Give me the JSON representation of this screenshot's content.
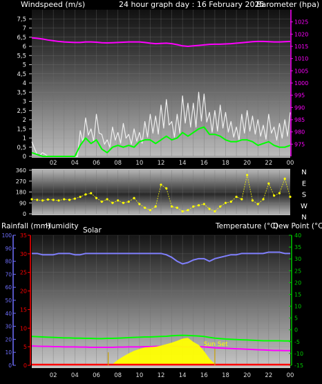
{
  "header": {
    "left": "Windspeed (m/s)",
    "center": "24 hour graph day : 16 February 2025",
    "right": "Barometer (hpa)"
  },
  "mid_header": {
    "rain": "Rainfall (mm)",
    "humidity": "Humidity",
    "solar": "Solar",
    "temperature": "Temperature (°C)",
    "dewpoint": "Dew Point (°C)"
  },
  "colors": {
    "wind_gust": "#f0f0f0",
    "wind_avg": "#00ff00",
    "barometer": "#ff00ff",
    "wind_dir": "#ffff00",
    "temperature": "#00ff00",
    "dewpoint": "#ff00ff",
    "humidity": "#8080ff",
    "solar": "#ffff00",
    "rain": "#ff0000",
    "rain_axis": "#ff0000",
    "humidity_axis": "#7070ff",
    "temp_axis": "#00cc00"
  },
  "x_ticks": [
    "02",
    "04",
    "06",
    "08",
    "10",
    "12",
    "14",
    "16",
    "18",
    "20",
    "22",
    "00"
  ],
  "chart_data": [
    {
      "type": "line",
      "id": "wind-baro",
      "title": "24 hour graph day : 16 February 2025",
      "ylabel": "Windspeed (m/s)",
      "y2label": "Barometer (hpa)",
      "ylim": [
        0,
        8
      ],
      "y2lim": [
        970,
        1030
      ],
      "y_ticks": [
        "0",
        "0,5",
        "1",
        "1,5",
        "2",
        "2,5",
        "3",
        "3,5",
        "4",
        "4,5",
        "5",
        "5,5",
        "6",
        "6,5",
        "7",
        "7,5"
      ],
      "y2_ticks": [
        "975",
        "980",
        "985",
        "990",
        "995",
        "1000",
        "1005",
        "1010",
        "1015",
        "1020",
        "1025"
      ],
      "x_hours": [
        0,
        0.5,
        1,
        1.5,
        2,
        2.5,
        3,
        3.5,
        4,
        4.5,
        5,
        5.5,
        6,
        6.5,
        7,
        7.5,
        8,
        8.5,
        9,
        9.5,
        10,
        10.5,
        11,
        11.5,
        12,
        12.5,
        13,
        13.5,
        14,
        14.5,
        15,
        15.5,
        16,
        16.5,
        17,
        17.5,
        18,
        18.5,
        19,
        19.5,
        20,
        20.5,
        21,
        21.5,
        22,
        22.5,
        23,
        23.5,
        24
      ],
      "series": [
        {
          "key": "barometer",
          "axis": "y2",
          "values": [
            1018.5,
            1018.3,
            1018,
            1017.6,
            1017.3,
            1017,
            1016.8,
            1016.7,
            1016.6,
            1016.6,
            1016.8,
            1016.8,
            1016.7,
            1016.5,
            1016.4,
            1016.5,
            1016.6,
            1016.7,
            1016.8,
            1016.8,
            1016.8,
            1016.6,
            1016.3,
            1016.1,
            1016.2,
            1016.3,
            1016.1,
            1015.7,
            1015.2,
            1015,
            1015.2,
            1015.4,
            1015.6,
            1015.8,
            1015.9,
            1015.9,
            1016,
            1016.1,
            1016.3,
            1016.5,
            1016.7,
            1016.9,
            1017,
            1017,
            1016.9,
            1016.8,
            1016.8,
            1016.9,
            1017
          ]
        },
        {
          "key": "wind_gust",
          "axis": "y",
          "values": [
            0.8,
            0.1,
            0.2,
            0,
            0,
            0,
            0,
            0,
            0,
            1.4,
            2.1,
            1.5,
            2.3,
            1.2,
            0.9,
            1.6,
            1.3,
            1.8,
            1.2,
            1.5,
            1.3,
            1.9,
            2.3,
            2.2,
            2.8,
            3.1,
            1.9,
            2.3,
            3.3,
            2.9,
            2.9,
            3.5,
            3.4,
            2.4,
            2.5,
            2.8,
            2.4,
            1.9,
            1.6,
            2.3,
            2.5,
            2.2,
            2.0,
            1.7,
            2.3,
            1.6,
            1.8,
            2.0,
            2.4
          ]
        },
        {
          "key": "wind_avg",
          "axis": "y",
          "values": [
            0.2,
            0.1,
            0,
            0,
            0,
            0,
            0,
            0,
            0,
            0.6,
            1.0,
            0.7,
            0.9,
            0.4,
            0.2,
            0.5,
            0.6,
            0.5,
            0.6,
            0.5,
            0.8,
            0.9,
            0.9,
            0.7,
            0.9,
            1.1,
            0.9,
            1.0,
            1.3,
            1.1,
            1.3,
            1.5,
            1.6,
            1.2,
            1.2,
            1.1,
            0.9,
            0.8,
            0.8,
            0.9,
            0.9,
            0.8,
            0.6,
            0.7,
            0.8,
            0.6,
            0.5,
            0.5,
            0.6
          ]
        }
      ]
    },
    {
      "type": "scatter",
      "id": "wind-direction",
      "ylim": [
        0,
        360
      ],
      "y_ticks": [
        "0",
        "90",
        "180",
        "270",
        "360"
      ],
      "y_labels_right": [
        "N",
        "W",
        "S",
        "E",
        "N"
      ],
      "x_hours": [
        0,
        0.5,
        1,
        1.5,
        2,
        2.5,
        3,
        3.5,
        4,
        4.5,
        5,
        5.5,
        6,
        6.5,
        7,
        7.5,
        8,
        8.5,
        9,
        9.5,
        10,
        10.5,
        11,
        11.5,
        12,
        12.5,
        13,
        13.5,
        14,
        14.5,
        15,
        15.5,
        16,
        16.5,
        17,
        17.5,
        18,
        18.5,
        19,
        19.5,
        20,
        20.5,
        21,
        21.5,
        22,
        22.5,
        23,
        23.5,
        24
      ],
      "series": [
        {
          "key": "wind_dir",
          "values": [
            120,
            115,
            110,
            118,
            115,
            110,
            120,
            115,
            125,
            140,
            160,
            170,
            130,
            100,
            120,
            90,
            110,
            90,
            100,
            130,
            80,
            50,
            30,
            60,
            240,
            210,
            60,
            50,
            20,
            30,
            60,
            70,
            80,
            40,
            20,
            60,
            90,
            100,
            140,
            120,
            320,
            110,
            80,
            120,
            250,
            150,
            170,
            290,
            140
          ]
        }
      ]
    },
    {
      "type": "line",
      "id": "temp-hum-rain-solar",
      "ylabel": "Rainfall (mm)",
      "y2label": "Temperature (°C)",
      "y_rain_lim": [
        0,
        35
      ],
      "y_rain_ticks": [
        "0",
        "5",
        "10",
        "15",
        "20",
        "25",
        "30",
        "35"
      ],
      "y_hum_lim": [
        0,
        100
      ],
      "y_hum_ticks": [
        "0",
        "10",
        "20",
        "30",
        "40",
        "50",
        "60",
        "70",
        "80",
        "90",
        "100"
      ],
      "y_temp_lim": [
        -15,
        40
      ],
      "y_temp_ticks": [
        "-15",
        "-10",
        "-5",
        "0",
        "5",
        "10",
        "15",
        "20",
        "25",
        "30",
        "35",
        "40"
      ],
      "sun_set_label": "Sun Set",
      "sun_set_hour": 17,
      "sunrise_hour": 7.1,
      "x_hours": [
        0,
        0.5,
        1,
        1.5,
        2,
        2.5,
        3,
        3.5,
        4,
        4.5,
        5,
        5.5,
        6,
        6.5,
        7,
        7.5,
        8,
        8.5,
        9,
        9.5,
        10,
        10.5,
        11,
        11.5,
        12,
        12.5,
        13,
        13.5,
        14,
        14.5,
        15,
        15.5,
        16,
        16.5,
        17,
        17.5,
        18,
        18.5,
        19,
        19.5,
        20,
        20.5,
        21,
        21.5,
        22,
        22.5,
        23,
        23.5,
        24
      ],
      "series": [
        {
          "key": "humidity",
          "axis": "hum",
          "values": [
            86,
            86,
            85,
            85,
            85,
            86,
            86,
            86,
            85,
            85,
            86,
            86,
            86,
            86,
            86,
            86,
            86,
            86,
            86,
            86,
            86,
            86,
            86,
            86,
            86,
            85,
            83,
            80,
            78,
            79,
            81,
            82,
            82,
            80,
            82,
            83,
            84,
            85,
            85,
            86,
            86,
            86,
            86,
            86,
            87,
            87,
            87,
            86,
            86
          ]
        },
        {
          "key": "temperature",
          "axis": "temp",
          "values": [
            -2.8,
            -2.9,
            -3,
            -3.1,
            -3.2,
            -3.3,
            -3.4,
            -3.4,
            -3.5,
            -3.5,
            -3.6,
            -3.6,
            -3.7,
            -3.7,
            -3.6,
            -3.6,
            -3.5,
            -3.4,
            -3.3,
            -3.2,
            -3.1,
            -3,
            -3,
            -2.9,
            -2.8,
            -2.7,
            -2.5,
            -2.4,
            -2.3,
            -2.4,
            -2.5,
            -2.6,
            -2.8,
            -3.2,
            -3.5,
            -3.7,
            -3.9,
            -4,
            -4.1,
            -4.2,
            -4.3,
            -4.4,
            -4.5,
            -4.6,
            -4.6,
            -4.6,
            -4.6,
            -4.7,
            -4.7
          ]
        },
        {
          "key": "dewpoint",
          "axis": "temp",
          "values": [
            -6.8,
            -6.9,
            -7,
            -7,
            -7.1,
            -7.1,
            -7.2,
            -7.2,
            -7.2,
            -7.3,
            -7.3,
            -7.4,
            -7.4,
            -7.4,
            -7.4,
            -7.4,
            -7.3,
            -7.3,
            -7.2,
            -7.2,
            -7.2,
            -7.1,
            -7.1,
            -7,
            -7,
            -6.9,
            -6.9,
            -7,
            -7.2,
            -7.3,
            -7.2,
            -7.1,
            -7.2,
            -7.4,
            -7.6,
            -7.7,
            -7.8,
            -7.9,
            -8,
            -8.1,
            -8.2,
            -8.3,
            -8.4,
            -8.5,
            -8.6,
            -8.7,
            -8.7,
            -8.8,
            -8.8
          ]
        },
        {
          "key": "solar",
          "axis": "rain",
          "values": [
            0,
            0,
            0,
            0,
            0,
            0,
            0,
            0,
            0,
            0,
            0,
            0,
            0,
            0,
            0,
            0.3,
            1.5,
            2.4,
            3.2,
            3.9,
            4.4,
            4.8,
            4.9,
            5,
            5.3,
            5.7,
            6.1,
            6.6,
            7.2,
            7.4,
            6.3,
            5.5,
            3.8,
            1.8,
            0.4,
            0,
            0,
            0,
            0,
            0,
            0,
            0,
            0,
            0,
            0,
            0,
            0,
            0,
            0
          ]
        },
        {
          "key": "rain",
          "axis": "rain",
          "values": [
            0,
            0,
            0,
            0,
            0,
            0,
            0,
            0,
            0,
            0,
            0,
            0,
            0,
            0,
            0,
            0,
            0,
            0,
            0,
            0,
            0,
            0,
            0,
            0,
            0,
            0,
            0,
            0,
            0,
            0,
            0,
            0,
            0,
            0,
            0,
            0,
            0,
            0,
            0,
            0,
            0,
            0,
            0,
            0,
            0,
            0,
            0,
            0,
            0
          ]
        }
      ]
    }
  ]
}
